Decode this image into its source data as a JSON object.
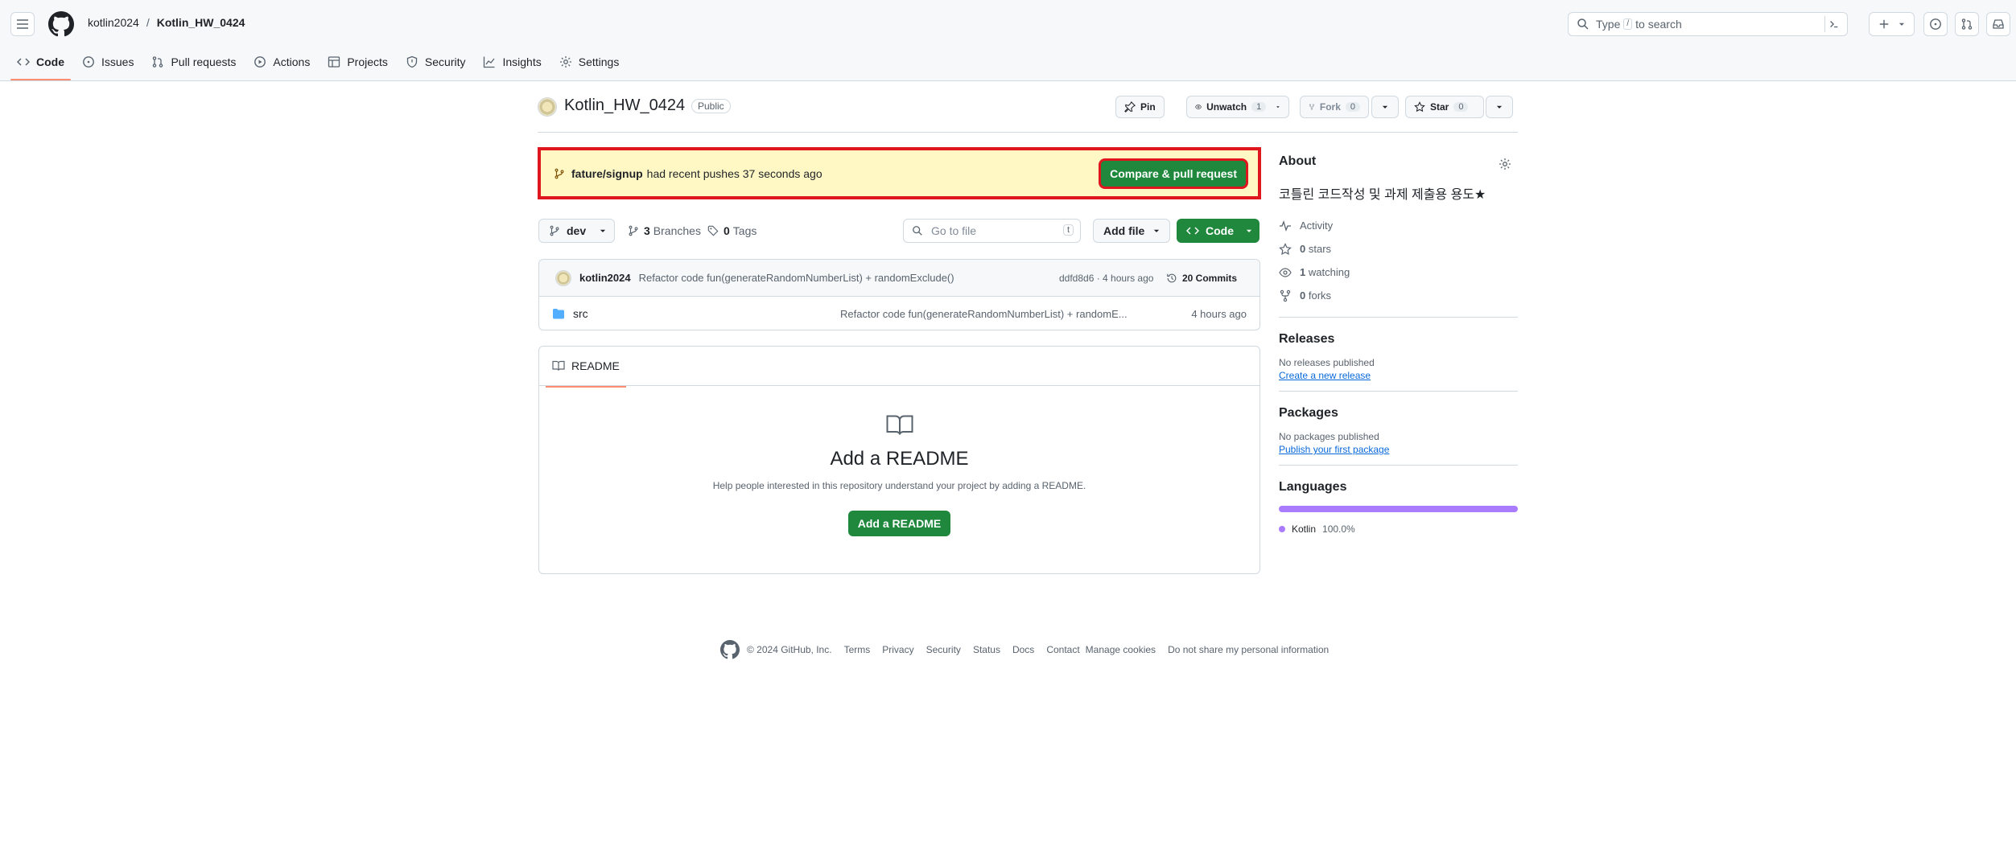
{
  "header": {
    "owner": "kotlin2024",
    "separator": "/",
    "repo": "Kotlin_HW_0424",
    "search": {
      "prefix": "Type",
      "key": "/",
      "suffix": "to search"
    }
  },
  "tabs": [
    {
      "label": "Code",
      "icon": "code-icon"
    },
    {
      "label": "Issues",
      "icon": "issue-icon"
    },
    {
      "label": "Pull requests",
      "icon": "pull-request-icon"
    },
    {
      "label": "Actions",
      "icon": "play-icon"
    },
    {
      "label": "Projects",
      "icon": "table-icon"
    },
    {
      "label": "Security",
      "icon": "shield-icon"
    },
    {
      "label": "Insights",
      "icon": "graph-icon"
    },
    {
      "label": "Settings",
      "icon": "gear-icon"
    }
  ],
  "repo_head": {
    "name": "Kotlin_HW_0424",
    "visibility": "Public",
    "pin_label": "Pin",
    "watch_label": "Unwatch",
    "watch_count": "1",
    "fork_label": "Fork",
    "fork_count": "0",
    "star_label": "Star",
    "star_count": "0"
  },
  "banner": {
    "branch": "fature/signup",
    "text": "had recent pushes 37 seconds ago",
    "button": "Compare & pull request"
  },
  "filenav": {
    "branch": "dev",
    "branches_count": "3",
    "branches_label": "Branches",
    "tags_count": "0",
    "tags_label": "Tags",
    "goto_placeholder": "Go to file",
    "goto_key": "t",
    "add_file": "Add file",
    "code": "Code"
  },
  "commit": {
    "author": "kotlin2024",
    "message": "Refactor code fun(generateRandomNumberList) + randomExclude()",
    "hash_time": "ddfd8d6 · 4 hours ago",
    "commits": "20 Commits"
  },
  "files": [
    {
      "name": "src",
      "message": "Refactor code fun(generateRandomNumberList) + randomE...",
      "time": "4 hours ago"
    }
  ],
  "readme": {
    "tab": "README",
    "title": "Add a README",
    "desc": "Help people interested in this repository understand your project by adding a README.",
    "button": "Add a README"
  },
  "sidebar": {
    "about_title": "About",
    "description": "코틀린 코드작성 및 과제 제출용 용도★",
    "stats": [
      {
        "icon": "pulse-icon",
        "count": "",
        "label": "Activity"
      },
      {
        "icon": "star-icon",
        "count": "0",
        "label": "stars"
      },
      {
        "icon": "eye-icon",
        "count": "1",
        "label": "watching"
      },
      {
        "icon": "fork-icon",
        "count": "0",
        "label": "forks"
      }
    ],
    "releases_title": "Releases",
    "releases_none": "No releases published",
    "releases_link": "Create a new release",
    "packages_title": "Packages",
    "packages_none": "No packages published",
    "packages_link": "Publish your first package",
    "languages_title": "Languages",
    "language": "Kotlin",
    "language_pct": "100.0%",
    "language_color": "#a97bff"
  },
  "footer": {
    "copyright": "© 2024 GitHub, Inc.",
    "links": [
      "Terms",
      "Privacy",
      "Security",
      "Status",
      "Docs",
      "Contact",
      "Manage cookies",
      "Do not share my personal information"
    ]
  },
  "colors": {
    "accent_green": "#1f883d",
    "highlight_red": "#e0161f",
    "banner_bg": "#fff8c5",
    "tab_underline": "#fd8c73"
  }
}
